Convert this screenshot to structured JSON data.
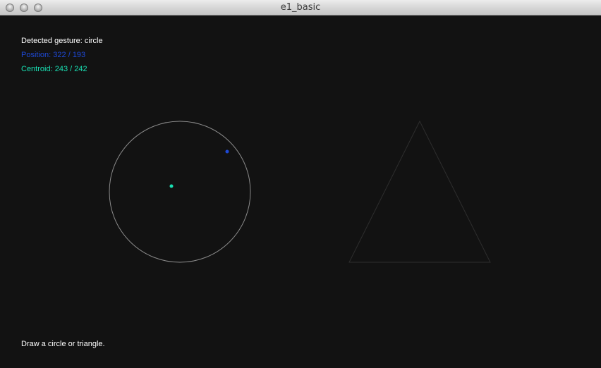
{
  "window": {
    "title": "e1_basic"
  },
  "status": {
    "gesture_label": "Detected gesture:",
    "gesture_value": "circle",
    "position_label": "Position:",
    "position_x": "322",
    "position_sep": "/",
    "position_y": "193",
    "centroid_label": "Centroid:",
    "centroid_x": "243",
    "centroid_y": "242"
  },
  "hint": "Draw a circle or triangle.",
  "colors": {
    "background": "#121212",
    "text": "#ffffff",
    "position": "#1e49d6",
    "centroid": "#19e0b3",
    "circle_outline": "#8a8a8a",
    "triangle_outline": "#2e2e2e"
  },
  "icons": [
    "close-button-icon",
    "minimize-button-icon",
    "zoom-button-icon"
  ]
}
